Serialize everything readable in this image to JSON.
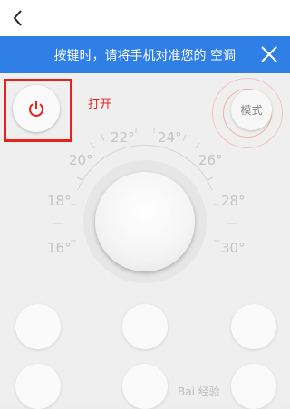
{
  "banner": {
    "text": "按键时，请将手机对准您的 空调"
  },
  "power": {
    "status": "打开"
  },
  "mode": {
    "label": "模式"
  },
  "dial": {
    "temperatures": {
      "t16": "16°",
      "t18": "18°",
      "t20": "20°",
      "t22": "22°",
      "t24": "24°",
      "t26": "26°",
      "t28": "28°",
      "t30": "30°"
    }
  },
  "icons": {
    "back": "chevron-left-icon",
    "close": "close-icon",
    "power": "power-icon"
  },
  "colors": {
    "banner": "#2f7fe6",
    "accent_red": "#e8221a",
    "temp_text": "#c4c4c4"
  },
  "watermark": "Bai 经验"
}
